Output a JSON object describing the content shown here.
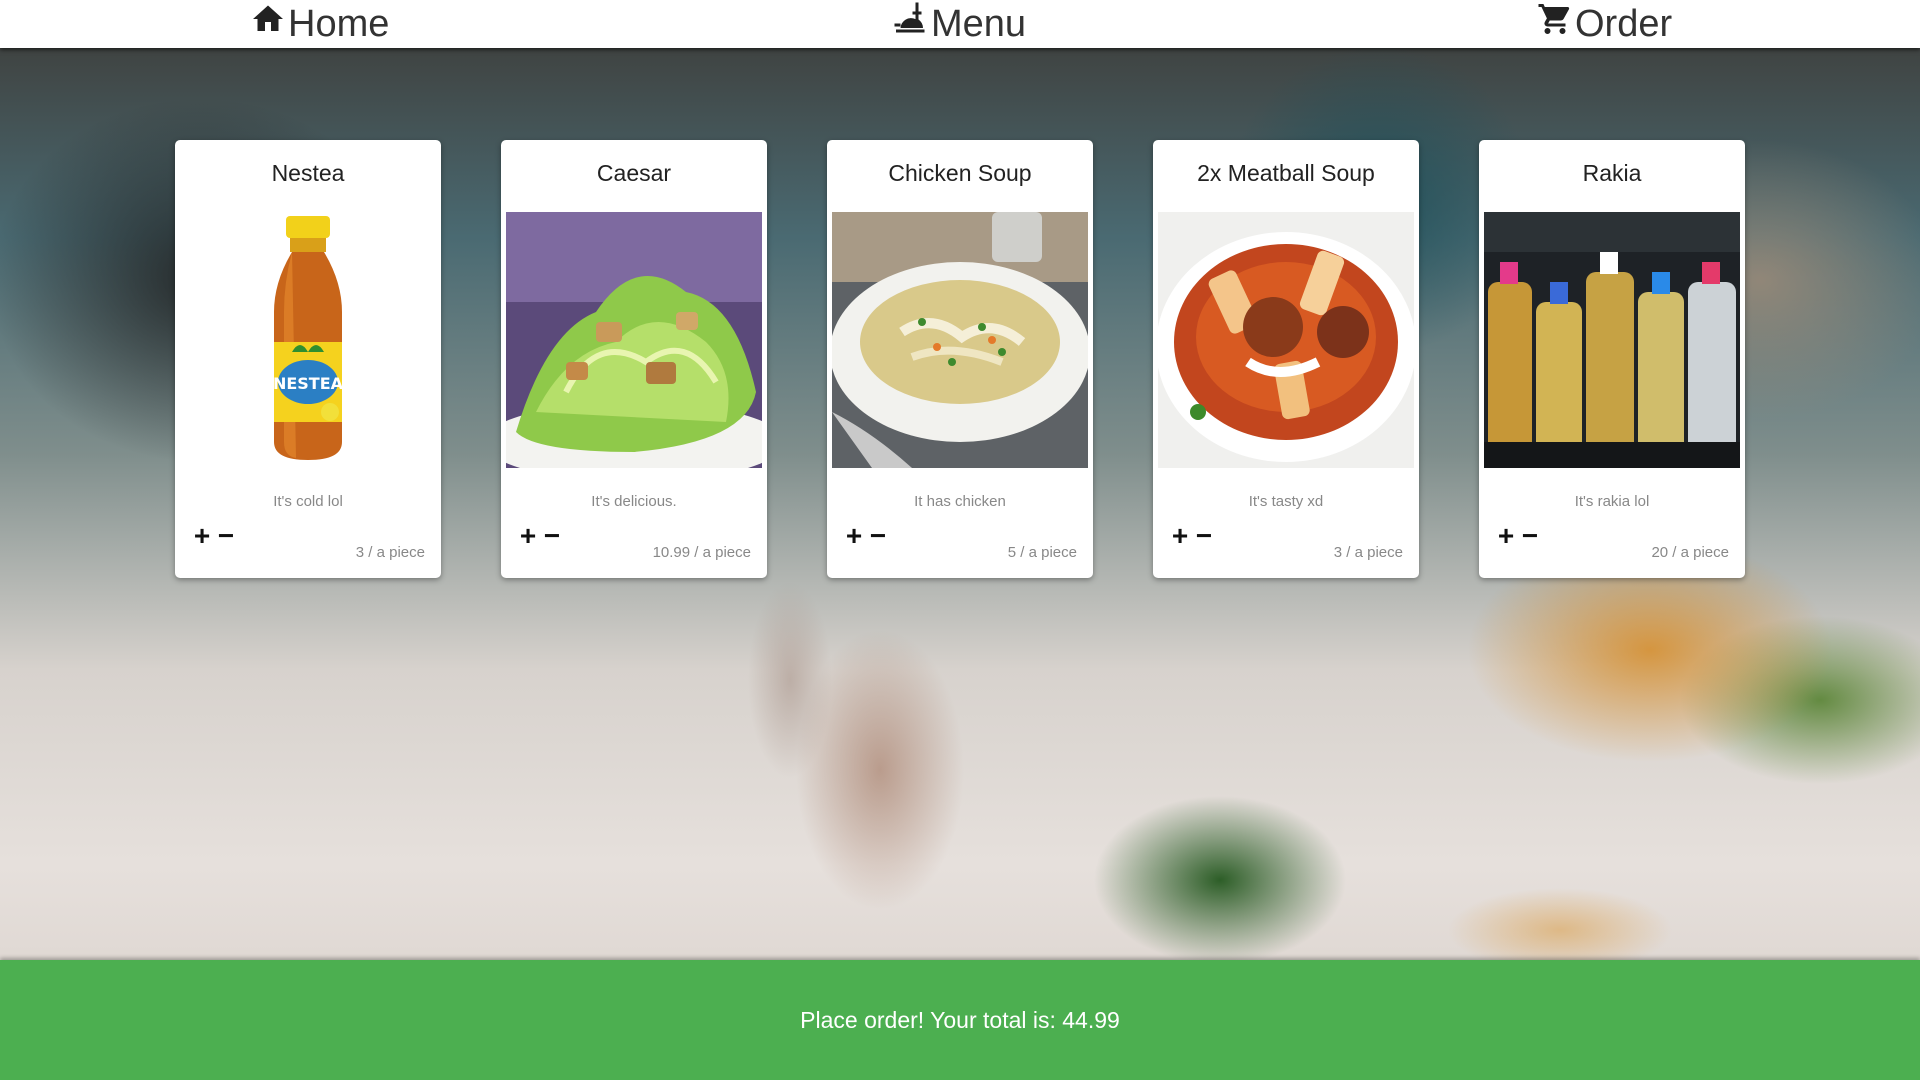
{
  "nav": {
    "home_label": "Home",
    "menu_label": "Menu",
    "order_label": "Order"
  },
  "menu_items": [
    {
      "title": "Nestea",
      "description": "It's cold lol",
      "price": "3 / a piece",
      "plus": "+",
      "minus": "−",
      "icon": "iced-tea-bottle"
    },
    {
      "title": "Caesar",
      "description": "It's delicious.",
      "price": "10.99 / a piece",
      "plus": "+",
      "minus": "−",
      "icon": "caesar-salad"
    },
    {
      "title": "Chicken Soup",
      "description": "It has chicken",
      "price": "5 / a piece",
      "plus": "+",
      "minus": "−",
      "icon": "chicken-soup"
    },
    {
      "title": "2x Meatball Soup",
      "description": "It's tasty xd",
      "price": "3 / a piece",
      "plus": "+",
      "minus": "−",
      "icon": "meatball-soup"
    },
    {
      "title": "Rakia",
      "description": "It's rakia lol",
      "price": "20 / a piece",
      "plus": "+",
      "minus": "−",
      "icon": "rakia-bottles"
    }
  ],
  "order_bar": {
    "label": "Place order! Your total is: 44.99"
  },
  "colors": {
    "order_bar": "#4caf50",
    "nav_bg": "#ffffff",
    "card_bg": "#ffffff"
  }
}
